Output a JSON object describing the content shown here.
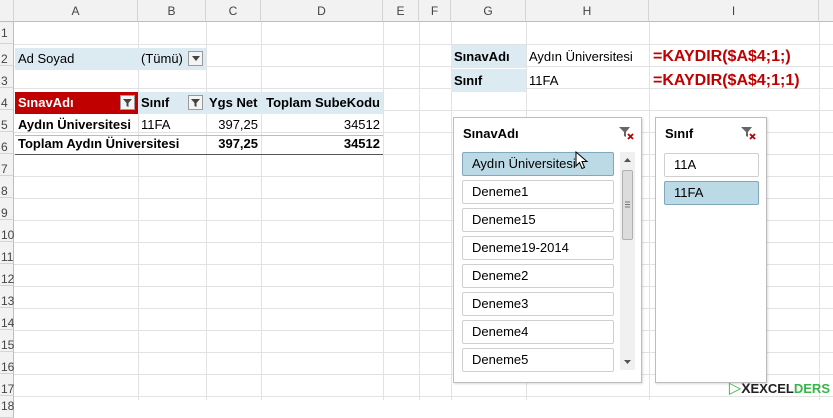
{
  "columns": [
    "A",
    "B",
    "C",
    "D",
    "E",
    "F",
    "G",
    "H",
    "I"
  ],
  "rows": [
    "1",
    "2",
    "3",
    "4",
    "5",
    "6",
    "7",
    "8",
    "9",
    "10",
    "11",
    "12",
    "13",
    "14",
    "15",
    "16",
    "17",
    "18"
  ],
  "report_filter": {
    "label": "Ad Soyad",
    "value": "(Tümü)"
  },
  "pivot": {
    "headers": [
      "SınavAdı",
      "Sınıf",
      "Ygs Net",
      "Toplam SubeKodu"
    ],
    "row1": [
      "Aydın Üniversitesi",
      "11FA",
      "397,25",
      "34512"
    ],
    "total": [
      "Toplam Aydın Üniversitesi",
      "397,25",
      "34512"
    ]
  },
  "lookup": {
    "label1": "SınavAdı",
    "value1": "Aydın Üniversitesi",
    "formula1": "=KAYDIR($A$4;1;)",
    "label2": "Sınıf",
    "value2": "11FA",
    "formula2": "=KAYDIR($A$4;1;1)"
  },
  "slicer_sinav": {
    "title": "SınavAdı",
    "items": [
      "Aydın Üniversitesi",
      "Deneme1",
      "Deneme15",
      "Deneme19-2014",
      "Deneme2",
      "Deneme3",
      "Deneme4",
      "Deneme5"
    ],
    "selected_index": 0
  },
  "slicer_sinif": {
    "title": "Sınıf",
    "items": [
      "11A",
      "11FA"
    ],
    "selected_index": 1
  },
  "watermark": {
    "left": "X",
    "mid": "EXCEL",
    "right": "DERS"
  },
  "colors": {
    "header_red": "#c00000",
    "formula_red": "#c00000",
    "pivot_blue": "#dcebf2",
    "slicer_selected": "#bcd9e6",
    "logo_green": "#38b449"
  }
}
